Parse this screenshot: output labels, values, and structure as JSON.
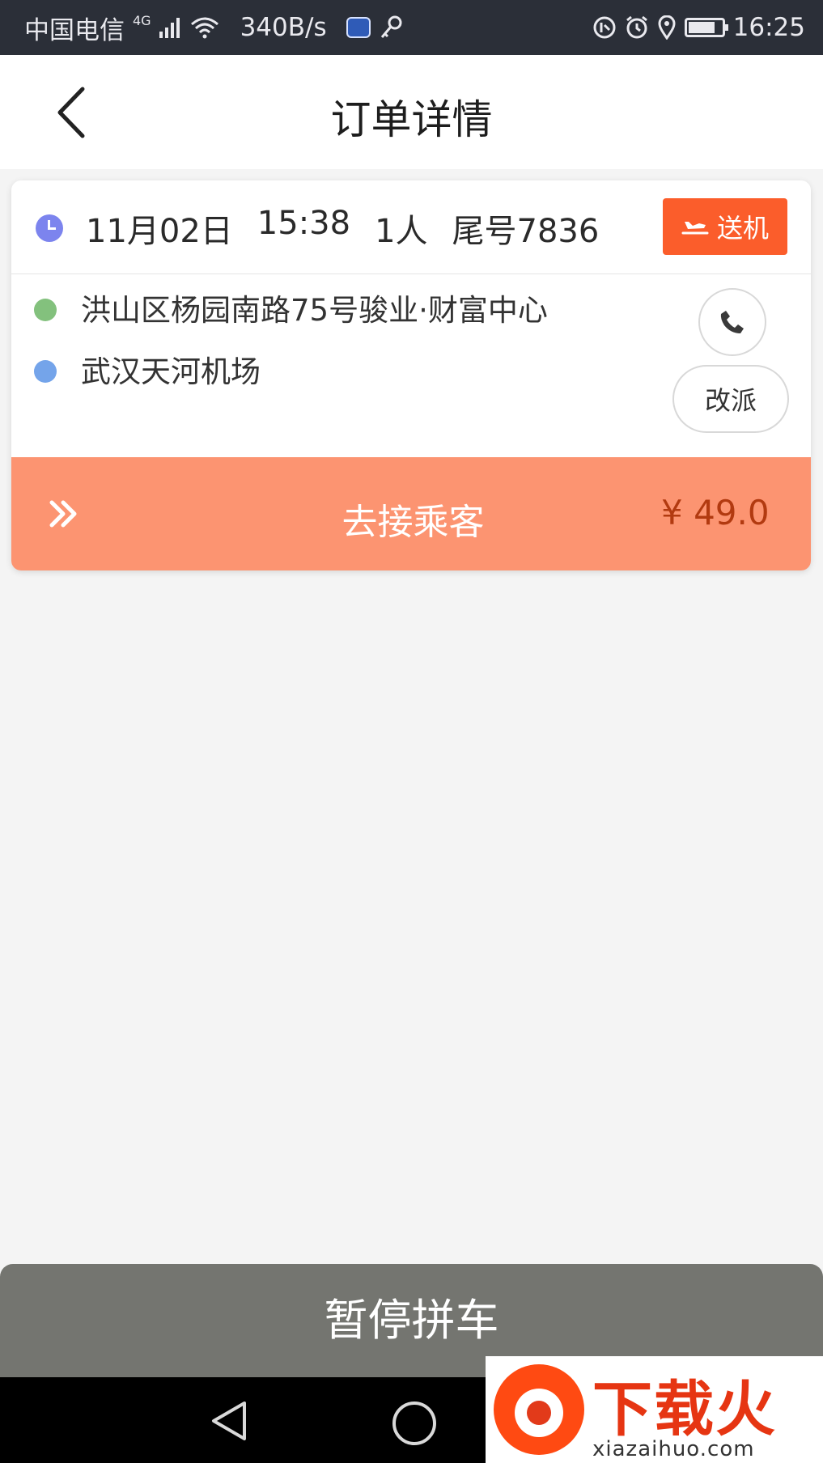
{
  "status_bar": {
    "carrier": "中国电信",
    "network_type": "4G",
    "net_speed": "340B/s",
    "time": "16:25",
    "battery_level": 0.8,
    "icons": [
      "signal-icon",
      "wifi-icon",
      "app-badge-icon",
      "key-icon",
      "data-saver-icon",
      "alarm-icon",
      "location-icon",
      "battery-icon"
    ]
  },
  "header": {
    "title": "订单详情"
  },
  "order": {
    "date": "11月02日",
    "time": "15:38",
    "passengers": "1人",
    "tail_number": "尾号7836",
    "type_label": "送机",
    "start_address": "洪山区杨园南路75号骏业·财富中心",
    "end_address": "武汉天河机场",
    "reassign_label": "改派"
  },
  "action": {
    "label": "去接乘客",
    "price": "¥ 49.0"
  },
  "bottom": {
    "pause_label": "暂停拼车"
  },
  "watermark": {
    "title": "下载火",
    "url": "xiazaihuo.com"
  },
  "colors": {
    "accent": "#fb5d2b",
    "action_bar": "#fc9471",
    "price": "#b23a10",
    "start_dot": "#83c17d",
    "end_dot": "#74a4ea"
  }
}
